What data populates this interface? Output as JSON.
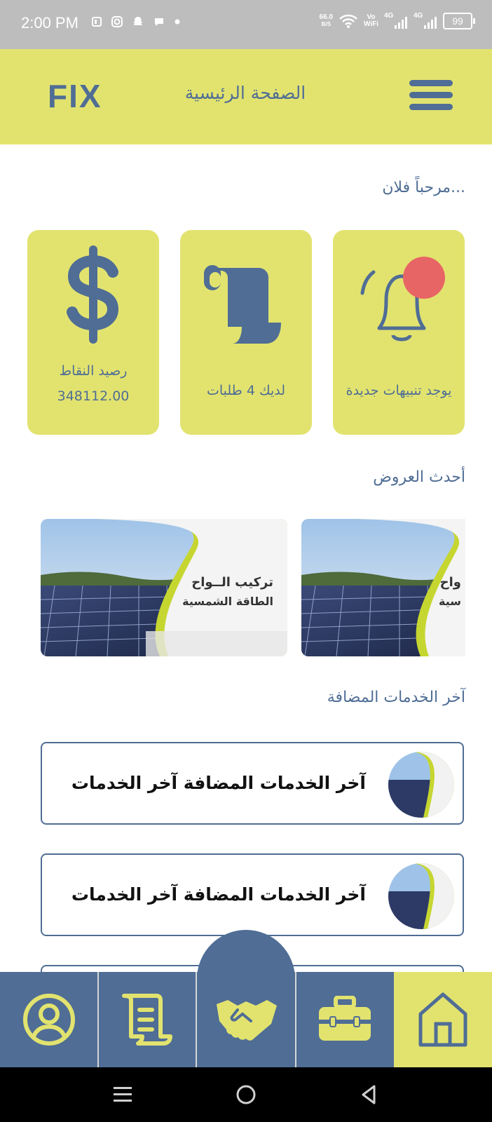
{
  "status_bar": {
    "time": "2:00 PM",
    "net_speed_value": "66.0",
    "net_speed_unit": "B/S",
    "vowifi_top": "Vo",
    "vowifi_bottom": "WiFi",
    "signal1_label": "4G",
    "signal2_label": "4G",
    "battery": "99"
  },
  "header": {
    "logo": "FIX",
    "title": "الصفحة الرئيسية"
  },
  "welcome": "...مرحباً فلان",
  "cards": {
    "points_label": "رصيد النقاط",
    "points_value": "348112.00",
    "requests_label": "لديك 4 طلبات",
    "notifications_label": "يوجد تنبيهات جديدة"
  },
  "offers_title": "أحدث العروض",
  "offers": [
    {
      "line1": "تركيب الــواح",
      "line2": "الطاقة الشمسية"
    },
    {
      "line1": "واح",
      "line2": "سية"
    }
  ],
  "services_title": "آخر الخدمات المضافة",
  "services": [
    {
      "label": "آخر الخدمات المضافة آخر الخدمات"
    },
    {
      "label": "آخر الخدمات المضافة آخر الخدمات"
    }
  ],
  "colors": {
    "accent_yellow": "#e2e36f",
    "primary_blue": "#4f6d95",
    "notification_dot": "#e86565"
  },
  "icons": {
    "nav": [
      "profile-icon",
      "scroll-icon",
      "handshake-icon",
      "toolbox-icon",
      "home-icon"
    ]
  }
}
